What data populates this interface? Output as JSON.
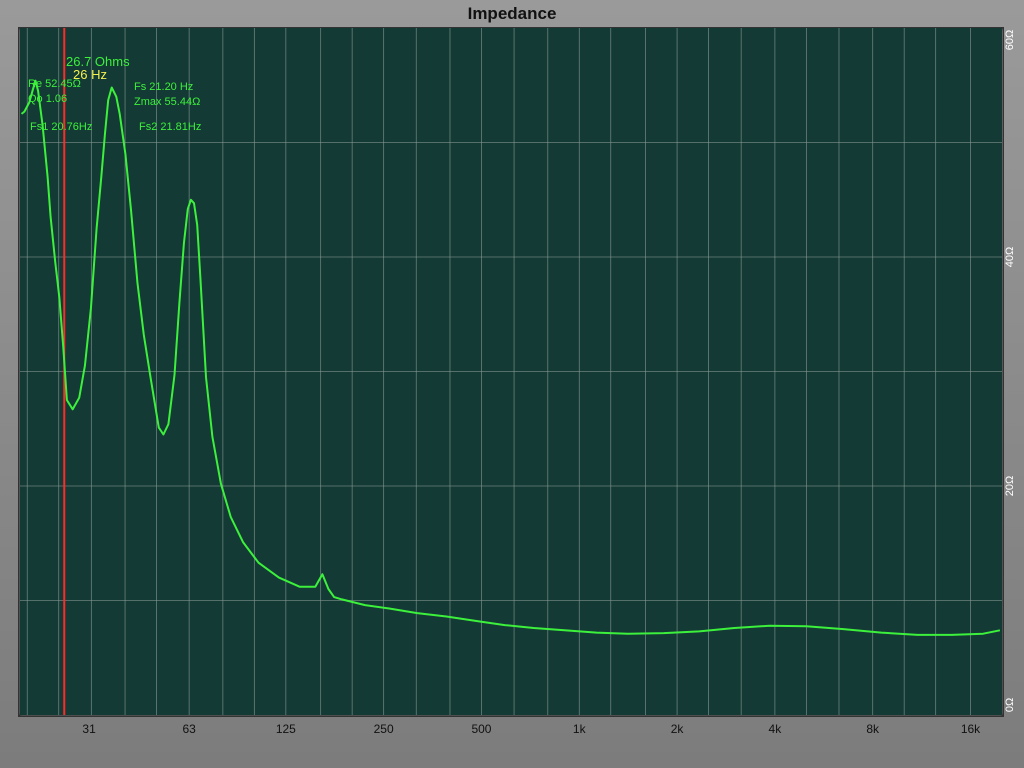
{
  "chart_data": {
    "type": "line",
    "title": "Impedance",
    "xscale": "log",
    "xlim": [
      19,
      20000
    ],
    "ylim": [
      0,
      60
    ],
    "x_ticks": [
      {
        "value": 31,
        "label": "31"
      },
      {
        "value": 63,
        "label": "63"
      },
      {
        "value": 125,
        "label": "125"
      },
      {
        "value": 250,
        "label": "250"
      },
      {
        "value": 500,
        "label": "500"
      },
      {
        "value": 1000,
        "label": "1k"
      },
      {
        "value": 2000,
        "label": "2k"
      },
      {
        "value": 4000,
        "label": "4k"
      },
      {
        "value": 8000,
        "label": "8k"
      },
      {
        "value": 16000,
        "label": "16k"
      }
    ],
    "y_ticks": [
      {
        "value": 0,
        "label": "0Ω"
      },
      {
        "value": 20,
        "label": "20Ω"
      },
      {
        "value": 40,
        "label": "40Ω"
      },
      {
        "value": 60,
        "label": "60Ω"
      }
    ],
    "grid": true,
    "background_color": "#133a34",
    "grid_color": "#8a9a96",
    "line_color": "#3cf03c",
    "series": [
      {
        "x": [
          19.2,
          19.6,
          20.3,
          20.8,
          21.2,
          21.6,
          22.3,
          23.1,
          23.6,
          24.4,
          25.1,
          25.8,
          26.5,
          27.6,
          28.9,
          30.1,
          31.4,
          32.7,
          33.8,
          34.7,
          35.5,
          36.4,
          37.6,
          38.5,
          40.1,
          41.7,
          43.7,
          45.7,
          47.9,
          50.8,
          52.5,
          54.4,
          56.8,
          58.8,
          60.7,
          62.4,
          63.8,
          65.2,
          66.7,
          68.3,
          71,
          74.3,
          78.9,
          84.6,
          92.3,
          103,
          119,
          138,
          154,
          162,
          169,
          176,
          186,
          219,
          260,
          317,
          390,
          485,
          590,
          724,
          900,
          1130,
          1410,
          1820,
          2340,
          3000,
          3850,
          5000,
          6500,
          8500,
          11000,
          14000,
          17500,
          19700
        ],
        "y": [
          52.5,
          52.7,
          53.5,
          54.6,
          55.4,
          54.5,
          51.5,
          47,
          43.5,
          39.5,
          36.5,
          32.2,
          27.5,
          26.7,
          27.7,
          30.5,
          35.5,
          42.5,
          47,
          50.8,
          53.7,
          54.8,
          54,
          52.5,
          49,
          44.2,
          37.7,
          33.2,
          29.5,
          25.1,
          24.5,
          25.4,
          29.7,
          36,
          41.2,
          44.2,
          45,
          44.7,
          42.8,
          38,
          29.5,
          24.3,
          20.2,
          17.3,
          15.1,
          13.3,
          12,
          11.2,
          11.2,
          12.3,
          11,
          10.3,
          10.1,
          9.6,
          9.3,
          8.9,
          8.6,
          8.2,
          7.85,
          7.6,
          7.4,
          7.2,
          7.1,
          7.15,
          7.3,
          7.6,
          7.8,
          7.75,
          7.5,
          7.2,
          7.0,
          7.0,
          7.1,
          7.4
        ]
      }
    ],
    "cursor": {
      "x": 26,
      "color": "#ff2a2a",
      "value_label": "26.7 Ohms",
      "freq_label": "26 Hz",
      "value_color": "#3cf03c",
      "freq_color": "#f5f050"
    },
    "annotations": [
      {
        "text": "Re 52.45Ω",
        "color": "#3cf03c"
      },
      {
        "text": "Qo 1.06",
        "color": "#3cf03c"
      },
      {
        "text": "Fs1 20.76Hz",
        "color": "#3cf03c"
      },
      {
        "text": "Fs 21.20 Hz",
        "color": "#3cf03c"
      },
      {
        "text": "Zmax 55.44Ω",
        "color": "#3cf03c"
      },
      {
        "text": "Fs2 21.81Hz",
        "color": "#3cf03c"
      }
    ]
  }
}
